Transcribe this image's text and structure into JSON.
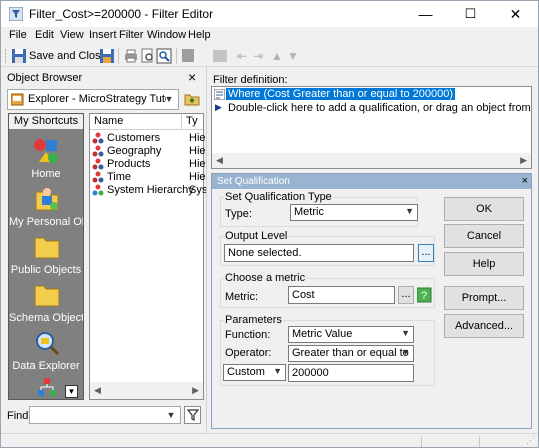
{
  "window": {
    "title": "Filter_Cost>=200000 - Filter Editor",
    "minimize": "—",
    "maximize": "☐",
    "close": "✕"
  },
  "menu": [
    "File",
    "Edit",
    "View",
    "Insert",
    "Filter",
    "Window",
    "Help"
  ],
  "toolbar": {
    "save_close_label": "Save and Close"
  },
  "object_browser": {
    "title": "Object Browser",
    "close": "×",
    "location": "Explorer - MicroStrategy Tutorial",
    "shortcuts_tab": "My Shortcuts",
    "shortcuts": [
      {
        "label": "Home",
        "icon": "home-icon"
      },
      {
        "label": "My Personal Ob...",
        "icon": "personal-objects-icon"
      },
      {
        "label": "Public Objects",
        "icon": "folder-icon"
      },
      {
        "label": "Schema Objects",
        "icon": "folder-icon"
      },
      {
        "label": "Data Explorer",
        "icon": "data-explorer-icon"
      }
    ],
    "columns": [
      "Name",
      "Ty"
    ],
    "items": [
      {
        "name": "Customers",
        "type": "Hie"
      },
      {
        "name": "Geography",
        "type": "Hie"
      },
      {
        "name": "Products",
        "type": "Hie"
      },
      {
        "name": "Time",
        "type": "Hie"
      },
      {
        "name": "System Hierarchy",
        "type": "Sys"
      }
    ],
    "find_label": "Find:",
    "find_value": ""
  },
  "filter_definition": {
    "title": "Filter definition:",
    "line1": "Where (Cost Greater than or equal to 200000)",
    "line2": "Double-click here to add a qualification, or drag an object from the objec"
  },
  "dialog": {
    "title": "Set Qualification",
    "close": "×",
    "type_group": "Set Qualification Type",
    "type_label": "Type:",
    "type_value": "Metric",
    "output_group": "Output Level",
    "output_value": "None selected.",
    "output_btn": "...",
    "metric_group": "Choose a metric",
    "metric_label": "Metric:",
    "metric_value": "Cost",
    "metric_btn": "...",
    "params_group": "Parameters",
    "function_label": "Function:",
    "function_value": "Metric Value",
    "operator_label": "Operator:",
    "operator_value": "Greater than or equal to",
    "value_type": "Custom",
    "value": "200000",
    "buttons": {
      "ok": "OK",
      "cancel": "Cancel",
      "help": "Help",
      "prompt": "Prompt...",
      "advanced": "Advanced..."
    }
  }
}
